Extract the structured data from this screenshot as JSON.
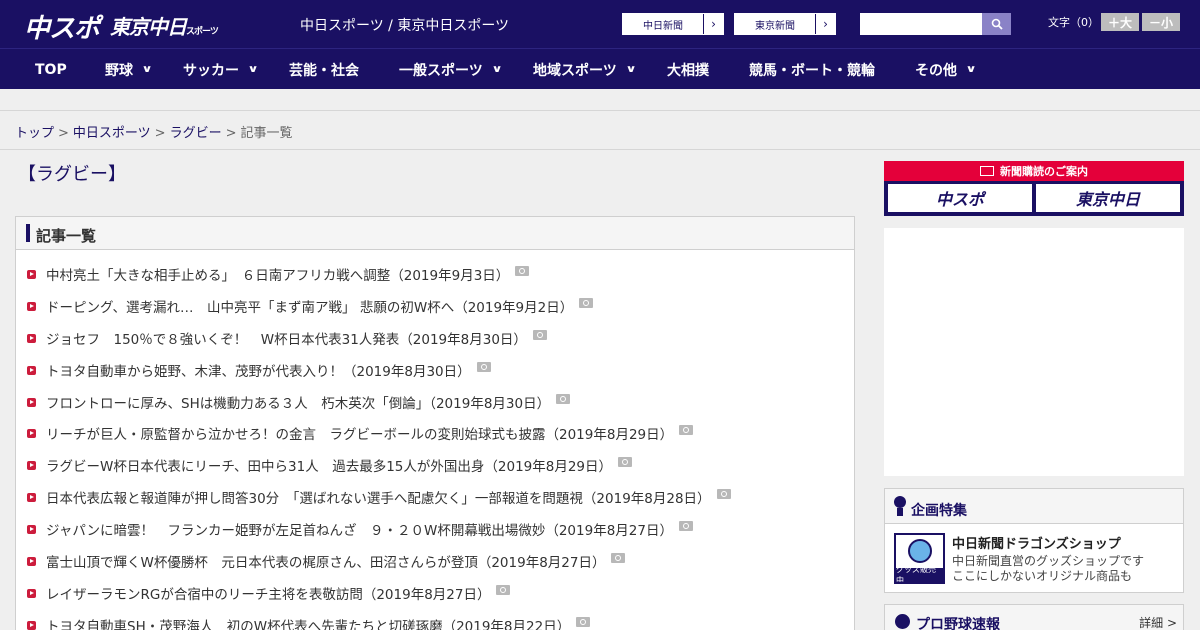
{
  "header": {
    "logo_chunichi": "中スポ",
    "logo_tokyo": "東京中日",
    "logo_tokyo_small": "スポーツ",
    "site_name": "中日スポーツ / 東京中日スポーツ",
    "paper_buttons": [
      "中日新聞",
      "東京新聞"
    ],
    "search_placeholder": "",
    "font_size_label": "文字（0）",
    "font_bigger": "＋大",
    "font_smaller": "－小"
  },
  "nav": {
    "items": [
      {
        "label": "TOP",
        "dropdown": false
      },
      {
        "label": "野球",
        "dropdown": true
      },
      {
        "label": "サッカー",
        "dropdown": true
      },
      {
        "label": "芸能・社会",
        "dropdown": false
      },
      {
        "label": "一般スポーツ",
        "dropdown": true
      },
      {
        "label": "地域スポーツ",
        "dropdown": true
      },
      {
        "label": "大相撲",
        "dropdown": false
      },
      {
        "label": "競馬・ボート・競輪",
        "dropdown": false
      },
      {
        "label": "その他",
        "dropdown": true
      }
    ]
  },
  "breadcrumb": {
    "items": [
      "トップ",
      "中日スポーツ",
      "ラグビー"
    ],
    "current": "記事一覧",
    "separator": ">"
  },
  "main": {
    "title": "【ラグビー】",
    "panel_title": "記事一覧",
    "articles": [
      "中村亮土「大きな相手止める」　６日南アフリカ戦へ調整（2019年9月3日）",
      "ドーピング、選考漏れ…　山中亮平「まず南ア戦」 悲願の初W杯へ（2019年9月2日）",
      "ジョセフ　150％で８強いくぞ！　W杯日本代表31人発表（2019年8月30日）",
      "トヨタ自動車から姫野、木津、茂野が代表入り！（2019年8月30日）",
      "フロントローに厚み、SHは機動力ある３人　朽木英次「倒論」（2019年8月30日）",
      "リーチが巨人・原監督から泣かせろ！の金言　ラグビーボールの変則始球式も披露（2019年8月29日）",
      "ラグビーW杯日本代表にリーチ、田中ら31人　過去最多15人が外国出身（2019年8月29日）",
      "日本代表広報と報道陣が押し問答30分　「選ばれない選手へ配慮欠く」一部報道を問題視（2019年8月28日）",
      "ジャパンに暗雲！　フランカー姫野が左足首ねんざ　９・２０W杯開幕戦出場微妙（2019年8月27日）",
      "富士山頂で輝くW杯優勝杯　元日本代表の梶原さん、田沼さんらが登頂（2019年8月27日）",
      "レイザーラモンRGが合宿中のリーチ主将を表敬訪問（2019年8月27日）",
      "トヨタ自動車SH・茂野海人　初のW杯代表へ先輩たちと切磋琢磨（2019年8月22日）"
    ]
  },
  "sidebar": {
    "subscription_title": "新聞購読のご案内",
    "subscription_boxes": [
      "中スポ",
      "東京中日"
    ],
    "feature_title": "企画特集",
    "feature_item_name": "中日新聞ドラゴンズショップ",
    "feature_item_desc_1": "中日新聞直営のグッズショップです",
    "feature_item_desc_2": "ここにしかないオリジナル商品も",
    "feature_thumb_label": "グッズ販売中",
    "baseball_title": "プロ野球速報",
    "baseball_more": "詳細 >"
  },
  "colors": {
    "brand_navy": "#1a1063",
    "accent_red": "#e4003a"
  }
}
